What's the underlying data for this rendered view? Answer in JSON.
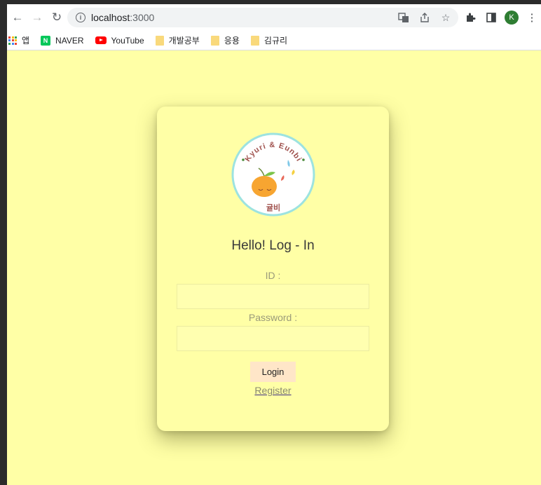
{
  "browser": {
    "url_host": "localhost",
    "url_port": ":3000",
    "avatar_letter": "K",
    "bookmarks": [
      {
        "label": "앱",
        "icon": "apps-grid-icon"
      },
      {
        "label": "NAVER",
        "icon": "naver-icon"
      },
      {
        "label": "YouTube",
        "icon": "youtube-icon"
      },
      {
        "label": "개발공부",
        "icon": "folder-icon"
      },
      {
        "label": "응용",
        "icon": "folder-icon"
      },
      {
        "label": "김규리",
        "icon": "folder-icon"
      }
    ]
  },
  "logo": {
    "top_text": "Kyuri & Eunbi",
    "bottom_text": "귤비"
  },
  "login": {
    "title": "Hello! Log - In",
    "id_label": "ID :",
    "id_value": "",
    "password_label": "Password :",
    "password_value": "",
    "login_button": "Login",
    "register_link": "Register"
  },
  "colors": {
    "page_bg": "#ffffa6",
    "button_bg": "#ffe6c8",
    "logo_ring": "#9de3e0"
  }
}
